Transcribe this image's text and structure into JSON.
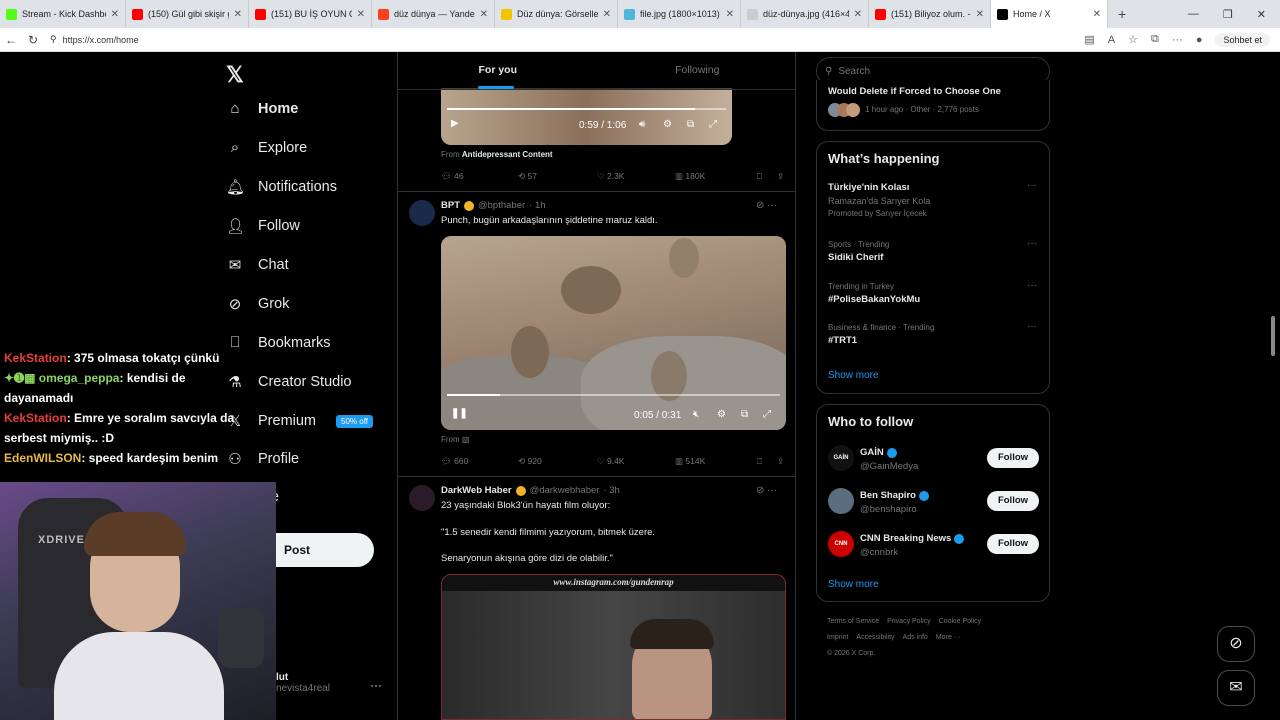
{
  "browser": {
    "tabs": [
      {
        "title": "Stream - Kick Dashboard",
        "color": "#53fc18"
      },
      {
        "title": "(150) Gül gibi skişir gidiyor",
        "color": "#ff0000"
      },
      {
        "title": "(151) BU İŞ OYUN OYNAMAK",
        "color": "#ff0000"
      },
      {
        "title": "düz dünya — Yandex: 22 bin",
        "color": "#fc3f1d"
      },
      {
        "title": "Düz dünya: Görselleri görüntüle",
        "color": "#f5c400"
      },
      {
        "title": "file.jpg (1800×1013)",
        "color": "#4fb6d9"
      },
      {
        "title": "düz-dünya.jpg (416×416)",
        "color": "#cccccc"
      },
      {
        "title": "(151) Biliyoz olum. - YouTube",
        "color": "#ff0000"
      },
      {
        "title": "Home / X",
        "color": "#000000"
      }
    ],
    "url": "https://x.com/home",
    "copilot_label": "Sohbet et"
  },
  "nav": {
    "items": [
      {
        "label": "Home",
        "icon": "home-icon",
        "glyph": "⌂"
      },
      {
        "label": "Explore",
        "icon": "search-icon",
        "glyph": "⌕"
      },
      {
        "label": "Notifications",
        "icon": "bell-icon",
        "glyph": "🔔︎"
      },
      {
        "label": "Follow",
        "icon": "person-add-icon",
        "glyph": "👤︎"
      },
      {
        "label": "Chat",
        "icon": "envelope-icon",
        "glyph": "✉"
      },
      {
        "label": "Grok",
        "icon": "grok-icon",
        "glyph": "⊘"
      },
      {
        "label": "Bookmarks",
        "icon": "bookmark-icon",
        "glyph": "⎕"
      },
      {
        "label": "Creator Studio",
        "icon": "flask-icon",
        "glyph": "⚗"
      },
      {
        "label": "Premium",
        "icon": "x-logo-icon",
        "glyph": "𝕏"
      },
      {
        "label": "Profile",
        "icon": "person-icon",
        "glyph": "⚇"
      },
      {
        "label": "ore",
        "icon": "more-icon",
        "glyph": ""
      }
    ],
    "premium_badge": "50% off",
    "post_label": "Post",
    "account_name": "lut",
    "account_handle": "nevista4real"
  },
  "stream_chat": [
    {
      "user": "KekStation",
      "msg": ": 375 olmasa tokatçı çünkü",
      "cls": "u1",
      "prefix": ""
    },
    {
      "user": "omega_peppa",
      "msg": ": kendisi de dayanamadı",
      "cls": "u2",
      "prefix": "✦➊▦ "
    },
    {
      "user": "KekStation",
      "msg": ": Emre ye soralım savcıyla da serbest miymiş.. :D",
      "cls": "u1",
      "prefix": ""
    },
    {
      "user": "EdenWILSON",
      "msg": ": speed kardeşim benim",
      "cls": "u3",
      "prefix": ""
    }
  ],
  "webcam": {
    "chair_brand": "XDRIVE"
  },
  "feed": {
    "tab_foryou": "For you",
    "tab_following": "Following",
    "tweet0": {
      "video_time": "0:59 / 1:06",
      "video_progress": 0.89,
      "from_label": "From",
      "from_source": "Antidepressant Content",
      "replies": "46",
      "reposts": "57",
      "likes": "2.3K",
      "views": "180K"
    },
    "tweet1": {
      "name": "BPT",
      "handle": "@bpthaber",
      "time": "· 1h",
      "text": "Punch, bugün arkadaşlarının şiddetine maruz kaldı.",
      "video_time": "0:05 / 0:31",
      "video_progress": 0.16,
      "from_label": "From",
      "replies": "660",
      "reposts": "920",
      "likes": "9.4K",
      "views": "514K"
    },
    "tweet2": {
      "name": "DarkWeb Haber",
      "handle": "@darkwebhaber",
      "time": "· 3h",
      "line1": "23 yaşındaki Blok3'ün hayatı film oluyor:",
      "line2": "\"1.5 senedir kendi filmimi yazıyorum, bitmek üzere.",
      "line3": "Senaryonun akışına göre dizi de olabilir.\"",
      "video_caption": "www.instagram.com/gundemrap"
    }
  },
  "right": {
    "search_placeholder": "Search",
    "top_card": {
      "title": "Would Delete if Forced to Choose One",
      "meta": "1 hour ago · Other · 2,776 posts"
    },
    "happening_title": "What’s happening",
    "trends": [
      {
        "ctx": "Türkiye'nin Kolası",
        "name": "Ramazan'da Sarıyer Kola",
        "sub": "Promoted by Sarıyer İçecek",
        "promoted": true
      },
      {
        "ctx": "Sports · Trending",
        "name": "Sidiki Cherif",
        "promoted": false
      },
      {
        "ctx": "Trending in Turkey",
        "name": "#PoliseBakanYokMu",
        "promoted": false
      },
      {
        "ctx": "Business & finance · Trending",
        "name": "#TRT1",
        "promoted": false
      }
    ],
    "show_more": "Show more",
    "wtf_title": "Who to follow",
    "wtf": [
      {
        "name": "GAİN",
        "handle": "@GainMedya",
        "avatar_text": "GAİN",
        "color": "#111111"
      },
      {
        "name": "Ben Shapiro",
        "handle": "@benshapiro",
        "avatar_text": "",
        "color": "#5b6e80"
      },
      {
        "name": "CNN Breaking News",
        "handle": "@cnnbrk",
        "avatar_text": "CNN",
        "color": "#cc0000"
      }
    ],
    "follow_label": "Follow",
    "footer": [
      "Terms of Service",
      "Privacy Policy",
      "Cookie Policy",
      "Imprint",
      "Accessibility",
      "Ads info",
      "More ···",
      "© 2026 X Corp."
    ]
  }
}
